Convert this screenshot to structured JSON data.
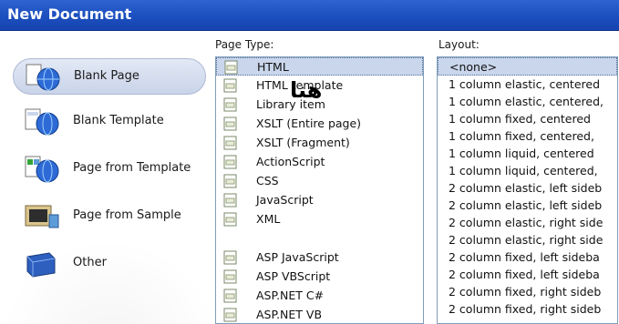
{
  "window": {
    "title": "New Document"
  },
  "annotation_overlay": "هنا",
  "categories": [
    {
      "label": "Blank Page",
      "icon": "blank-page-icon",
      "selected": true
    },
    {
      "label": "Blank Template",
      "icon": "blank-template-icon",
      "selected": false
    },
    {
      "label": "Page from Template",
      "icon": "page-from-template-icon",
      "selected": false
    },
    {
      "label": "Page from Sample",
      "icon": "page-from-sample-icon",
      "selected": false
    },
    {
      "label": "Other",
      "icon": "other-icon",
      "selected": false
    }
  ],
  "page_type": {
    "header": "Page Type:",
    "items": [
      {
        "label": "HTML",
        "selected": true
      },
      {
        "label": "HTML template"
      },
      {
        "label": "Library item"
      },
      {
        "label": "XSLT (Entire page)"
      },
      {
        "label": "XSLT (Fragment)"
      },
      {
        "label": "ActionScript"
      },
      {
        "label": "CSS"
      },
      {
        "label": "JavaScript"
      },
      {
        "label": "XML"
      },
      {
        "label": ""
      },
      {
        "label": "ASP JavaScript"
      },
      {
        "label": "ASP VBScript"
      },
      {
        "label": "ASP.NET C#"
      },
      {
        "label": "ASP.NET VB"
      }
    ]
  },
  "layout": {
    "header": "Layout:",
    "items": [
      {
        "label": "<none>",
        "selected": true
      },
      {
        "label": "1 column elastic, centered"
      },
      {
        "label": "1 column elastic, centered,"
      },
      {
        "label": "1 column fixed, centered"
      },
      {
        "label": "1 column fixed, centered,"
      },
      {
        "label": "1 column liquid, centered"
      },
      {
        "label": "1 column liquid, centered,"
      },
      {
        "label": "2 column elastic, left sideb"
      },
      {
        "label": "2 column elastic, left sideb"
      },
      {
        "label": "2 column elastic, right side"
      },
      {
        "label": "2 column elastic, right side"
      },
      {
        "label": "2 column fixed, left sideba"
      },
      {
        "label": "2 column fixed, left sideba"
      },
      {
        "label": "2 column fixed, right sideb"
      },
      {
        "label": "2 column fixed, right sideb"
      }
    ]
  },
  "colors": {
    "titlebar": "#1c4fbf",
    "selection": "#c9d6ec",
    "list_border": "#7f9db9"
  }
}
